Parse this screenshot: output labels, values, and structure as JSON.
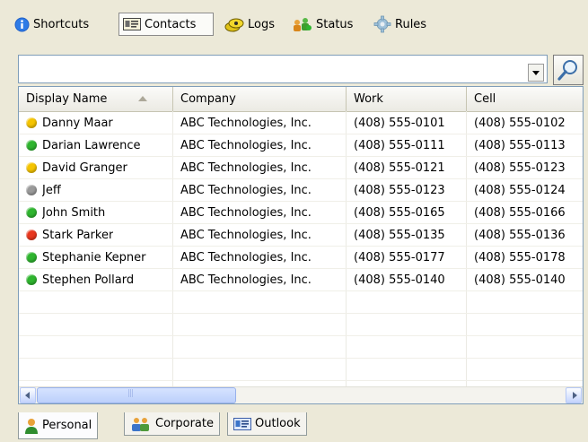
{
  "top_tabs": [
    {
      "label": "Shortcuts",
      "icon": "info-icon"
    },
    {
      "label": "Contacts",
      "icon": "address-card-icon",
      "active": true
    },
    {
      "label": "Logs",
      "icon": "logs-icon"
    },
    {
      "label": "Status",
      "icon": "status-people-icon"
    },
    {
      "label": "Rules",
      "icon": "gear-icon"
    }
  ],
  "search": {
    "value": "",
    "placeholder": ""
  },
  "columns": [
    "Display Name",
    "Company",
    "Work",
    "Cell"
  ],
  "rows": [
    {
      "status": "away",
      "name": "Danny Maar",
      "company": "ABC Technologies, Inc.",
      "work": "(408) 555-0101",
      "cell": "(408) 555-0102"
    },
    {
      "status": "online",
      "name": "Darian Lawrence",
      "company": "ABC Technologies, Inc.",
      "work": "(408) 555-0111",
      "cell": "(408) 555-0113"
    },
    {
      "status": "away",
      "name": "David Granger",
      "company": "ABC Technologies, Inc.",
      "work": "(408) 555-0121",
      "cell": "(408) 555-0123"
    },
    {
      "status": "offline",
      "name": "Jeff",
      "company": "ABC Technologies, Inc.",
      "work": "(408) 555-0123",
      "cell": "(408) 555-0124"
    },
    {
      "status": "online",
      "name": "John Smith",
      "company": "ABC Technologies, Inc.",
      "work": "(408) 555-0165",
      "cell": "(408) 555-0166"
    },
    {
      "status": "busy",
      "name": "Stark Parker",
      "company": "ABC Technologies, Inc.",
      "work": "(408) 555-0135",
      "cell": "(408) 555-0136"
    },
    {
      "status": "online",
      "name": "Stephanie Kepner",
      "company": "ABC Technologies, Inc.",
      "work": "(408) 555-0177",
      "cell": "(408) 555-0178"
    },
    {
      "status": "online",
      "name": "Stephen Pollard",
      "company": "ABC Technologies, Inc.",
      "work": "(408) 555-0140",
      "cell": "(408) 555-0140"
    }
  ],
  "status_colors": {
    "online": "#2fb52f",
    "away": "#f5c400",
    "busy": "#e8371e",
    "offline": "#9a9a9a"
  },
  "bottom_tabs": [
    {
      "label": "Personal",
      "icon": "person-icon",
      "active": true
    },
    {
      "label": "Corporate",
      "icon": "group-icon"
    },
    {
      "label": "Outlook",
      "icon": "outlook-card-icon"
    }
  ]
}
